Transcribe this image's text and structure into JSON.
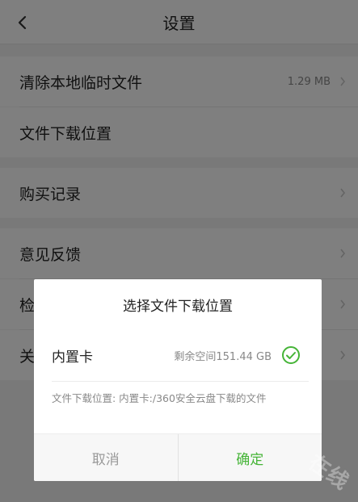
{
  "header": {
    "title": "设置",
    "back_icon": "chevron-left-icon"
  },
  "settings": {
    "rows": [
      {
        "label": "清除本地临时文件",
        "value": "1.29 MB"
      },
      {
        "label": "文件下载位置",
        "value": ""
      },
      {
        "label": "购买记录",
        "value": ""
      },
      {
        "label": "意见反馈",
        "value": ""
      },
      {
        "label": "检",
        "value": ""
      },
      {
        "label": "关",
        "value": ""
      }
    ]
  },
  "dialog": {
    "title": "选择文件下载位置",
    "option": {
      "name": "内置卡",
      "free_space": "剩余空间151.44 GB",
      "selected": true
    },
    "path_text": "文件下载位置: 内置卡:/360安全云盘下载的文件",
    "cancel_label": "取消",
    "confirm_label": "确定"
  },
  "colors": {
    "accent_green": "#45b437",
    "overlay": "rgba(0,0,0,0.5)"
  },
  "watermark": "在线"
}
